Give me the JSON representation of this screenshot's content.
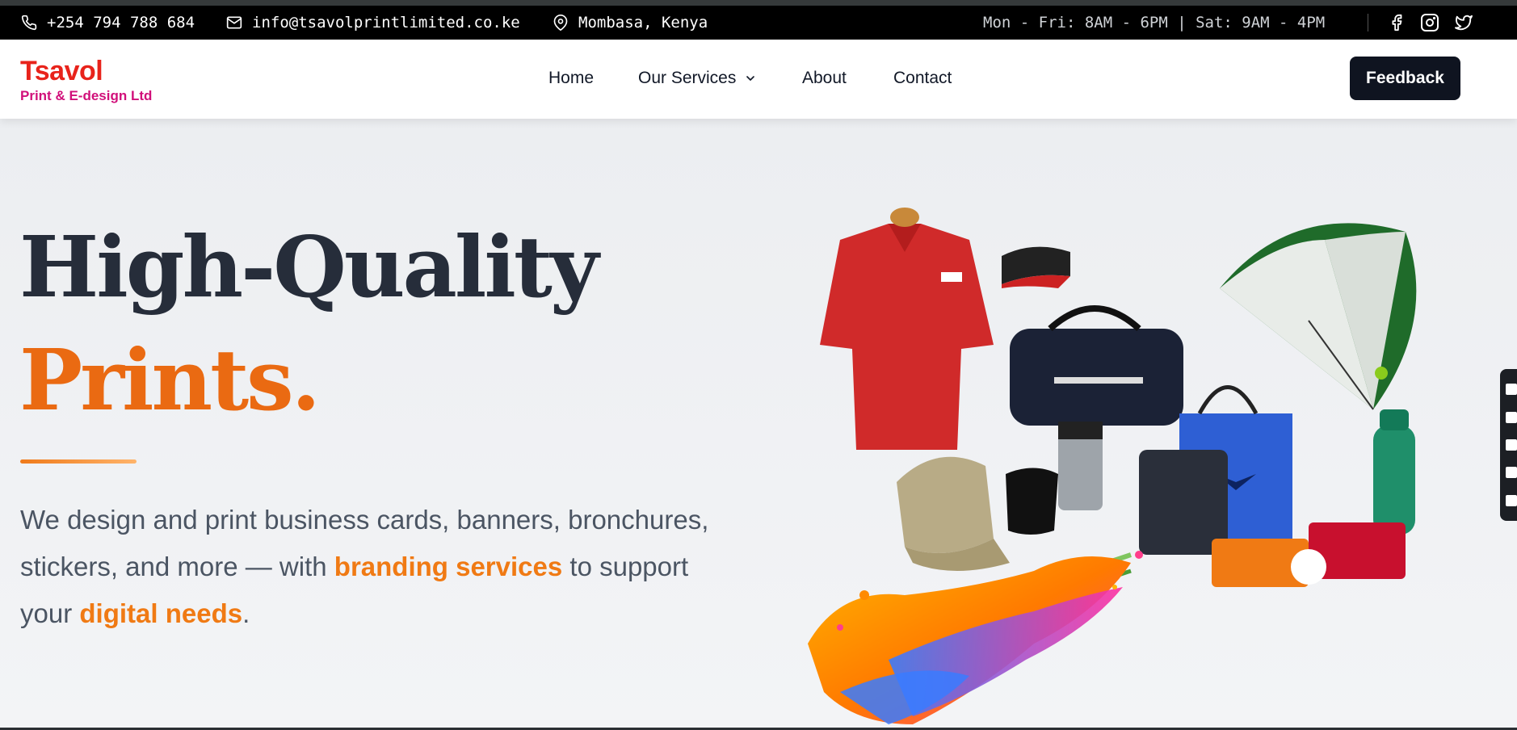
{
  "topbar": {
    "phone": "+254 794 788 684",
    "email": "info@tsavolprintlimited.co.ke",
    "location": "Mombasa, Kenya",
    "hours": "Mon - Fri: 8AM - 6PM | Sat: 9AM - 4PM",
    "icons": [
      "phone-icon",
      "mail-icon",
      "map-pin-icon",
      "facebook-icon",
      "instagram-icon",
      "twitter-icon"
    ]
  },
  "brand": {
    "name": "Tsavol",
    "tagline": "Print & E-design Ltd",
    "name_color": "#e8231b",
    "tagline_color": "#d10f7a"
  },
  "nav": {
    "items": [
      {
        "label": "Home"
      },
      {
        "label": "Our Services",
        "dropdown": true
      },
      {
        "label": "About"
      },
      {
        "label": "Contact"
      }
    ],
    "feedback_label": "Feedback"
  },
  "hero": {
    "heading_line1": "High-Quality",
    "heading_line2": "Prints.",
    "desc_part1": "We design and print business cards, banners, bronchures, stickers, and more — with ",
    "desc_highlight1": "branding services",
    "desc_part2": " to support your ",
    "desc_highlight2": "digital needs",
    "desc_part3": ".",
    "accent_color": "#f07a14",
    "image_alt": "Branded promotional merchandise with paint splash"
  }
}
